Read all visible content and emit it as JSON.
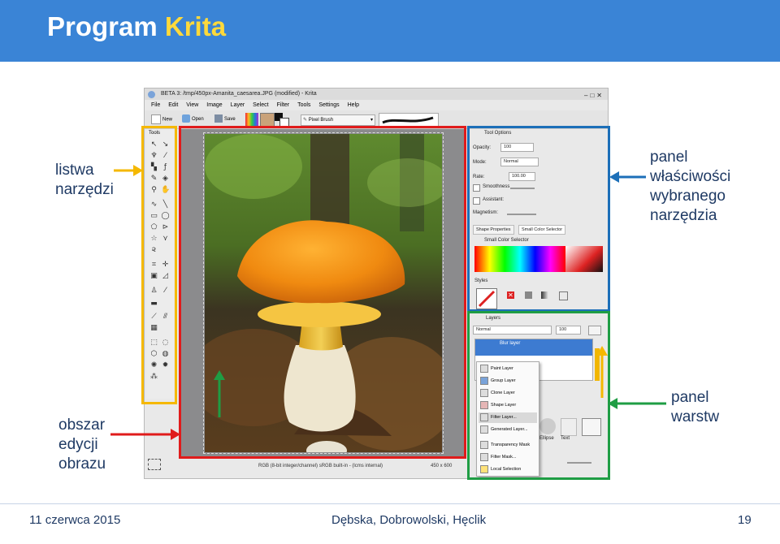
{
  "slide": {
    "title_part1": "Program ",
    "title_part2": "Krita",
    "accent_color": "#ffd93b",
    "header_color": "#3a84d6"
  },
  "annotations": {
    "toolbox": {
      "line1": "listwa",
      "line2": "narzędzi",
      "color": "#f5b800"
    },
    "tool_options": {
      "line1": "panel",
      "line2": "właściwości",
      "line3": "wybranego",
      "line4": "narzędzia",
      "color": "#1c6fb8"
    },
    "layers": {
      "line1": "panel",
      "line2": "warstw",
      "color": "#1f9d44"
    },
    "canvas": {
      "line1": "obszar",
      "line2": "edycji",
      "line3": "obrazu",
      "color": "#e01b1b"
    }
  },
  "footer": {
    "date": "11 czerwca 2015",
    "authors": "Dębska, Dobrowolski, Hęclik",
    "page": "19"
  },
  "krita": {
    "window_title": "BETA 3: /tmp/450px-Amanita_caesarea.JPG (modified) - Krita",
    "menu": [
      "File",
      "Edit",
      "View",
      "Image",
      "Layer",
      "Select",
      "Filter",
      "Tools",
      "Settings",
      "Help"
    ],
    "toolbar": {
      "new": "New",
      "open": "Open",
      "save": "Save",
      "brush": "Pixel Brush"
    },
    "toolbox_title": "Tools",
    "tool_options": {
      "title": "Tool Options",
      "opacity_label": "Opacity:",
      "opacity_value": "100",
      "mode_label": "Mode:",
      "mode_value": "Normal",
      "rate_label": "Rate:",
      "rate_value": "100.00",
      "smoothness": "Smoothness",
      "assistant": "Assistant:",
      "magnetism": "Magnetism:"
    },
    "tabs": [
      "Shape Properties",
      "Small Color Selector"
    ],
    "color_selector_title": "Small Color Selector",
    "styles_title": "Styles",
    "layers": {
      "title": "Layers",
      "blend_mode": "Normal",
      "opacity": "100",
      "blur_layer": "Blur layer"
    },
    "add_layer_menu": [
      "Paint Layer",
      "Group Layer",
      "Clone Layer",
      "Shape Layer",
      "Filter Layer...",
      "Generated Layer...",
      "Transparency Mask",
      "Filter Mask...",
      "Local Selection"
    ],
    "shapes": {
      "ellipse": "Ellipse",
      "text": "Text"
    },
    "status": {
      "color_space": "RGB (8-bit integer/channel)  sRGB built-in - (lcms internal)",
      "size": "450 x 600"
    }
  }
}
